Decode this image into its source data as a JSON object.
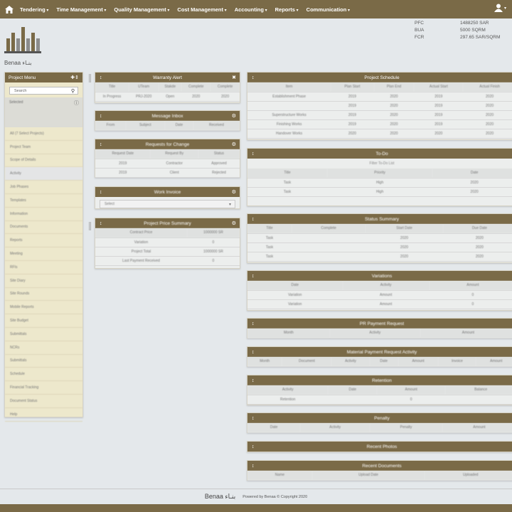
{
  "nav": {
    "home_icon": "home-icon",
    "items": [
      "Tendering",
      "Time Management",
      "Quality Management",
      "Cost Management",
      "Accounting",
      "Reports",
      "Communication"
    ],
    "user_icon": "user-icon"
  },
  "logo": {
    "text": "Benaa بنـاء"
  },
  "project_info": {
    "rows": [
      {
        "label": "PFC",
        "value": "1488250 SAR"
      },
      {
        "label": "BUA",
        "value": "5000 SQRM"
      },
      {
        "label": "FCR",
        "value": "297.65 SAR/SQRM"
      }
    ]
  },
  "project_menu": {
    "title": "Project Menu",
    "search_placeholder": "Search",
    "items": [
      "All (7 Select Projects)",
      "Project Team",
      "Scope of Details",
      "Activity",
      "Job Phases",
      "Templates",
      "Information",
      "Documents",
      "Reports",
      "Meeting",
      "RFIs",
      "Site Diary",
      "Site Rounds",
      "Mobile Reports",
      "Site Budget",
      "Submittals",
      "NCRs",
      "Submittals",
      "Schedule",
      "Financial Tracking",
      "Document Status",
      "Help"
    ],
    "selected_index": 3
  },
  "panels": {
    "warranty": {
      "title": "Warranty Alert",
      "columns": [
        "Title",
        "UTeam",
        "Stakde",
        "Complete",
        "Complete"
      ],
      "row": [
        "In Progress",
        "PRJ-2020",
        "Open",
        "2020",
        "2020"
      ]
    },
    "message": {
      "title": "Message Inbox",
      "columns": [
        "From",
        "Subject",
        "Date",
        "Received"
      ]
    },
    "requests": {
      "title": "Requests for Change",
      "columns": [
        "Request Date",
        "Request By",
        "Status"
      ],
      "rows": [
        [
          "2019",
          "Contractor",
          "Approved"
        ],
        [
          "2019",
          "Client",
          "Rejected"
        ]
      ]
    },
    "work_invoice": {
      "title": "Work Invoice",
      "dropdown": "Select"
    },
    "price": {
      "title": "Project Price Summary",
      "rows": [
        [
          "Contract Price",
          "1000000 SR"
        ],
        [
          "Variation",
          "0"
        ],
        [
          "Project Total",
          "1000000 SR"
        ],
        [
          "Last Payment Received",
          "0"
        ]
      ]
    },
    "schedule": {
      "title": "Project Schedule",
      "columns": [
        "Item",
        "Plan Start",
        "Plan End",
        "Actual Start",
        "Actual Finish"
      ],
      "rows": [
        [
          "Establishment Phase",
          "2019",
          "2020",
          "2019",
          "2020"
        ],
        [
          "",
          "2019",
          "2020",
          "2019",
          "2020"
        ],
        [
          "Superstructure Works",
          "2019",
          "2020",
          "2019",
          "2020"
        ],
        [
          "Finishing Works",
          "2019",
          "2020",
          "2019",
          "2020"
        ],
        [
          "Handover Works",
          "2020",
          "2020",
          "2020",
          "2020"
        ]
      ]
    },
    "todo": {
      "title": "To-Do",
      "subtitle": "Filter To-Do List",
      "columns": [
        "Title",
        "Priority",
        "Date"
      ],
      "rows": [
        [
          "Task",
          "High",
          "2020"
        ],
        [
          "Task",
          "High",
          "2020"
        ]
      ]
    },
    "status": {
      "title": "Status Summary",
      "columns": [
        "Title",
        "Complete",
        "Start Date",
        "Due Date"
      ],
      "rows": [
        [
          "Task",
          "",
          "2020",
          "2020"
        ],
        [
          "Task",
          "",
          "2020",
          "2020"
        ],
        [
          "Task",
          "",
          "2020",
          "2020"
        ]
      ]
    },
    "variations": {
      "title": "Variations",
      "columns": [
        "Date",
        "Activity",
        "Amount"
      ],
      "rows": [
        [
          "Variation",
          "Amount",
          "0"
        ],
        [
          "Variation",
          "Amount",
          "0"
        ]
      ]
    },
    "pr_request": {
      "title": "PR Payment Request",
      "columns": [
        "Month",
        "Activity",
        "Amount"
      ]
    },
    "material": {
      "title": "Material Payment Request Activity",
      "columns": [
        "Month",
        "Document",
        "Activity",
        "Date",
        "Amount",
        "Invoice",
        "Amount"
      ]
    },
    "retention": {
      "title": "Retention",
      "columns": [
        "Activity",
        "Date",
        "Amount",
        "Balance"
      ],
      "row": [
        "Retention",
        "",
        "0",
        ""
      ]
    },
    "penalty": {
      "title": "Penalty",
      "columns": [
        "Date",
        "Activity",
        "Penalty",
        "Amount"
      ]
    },
    "recent_photos": {
      "title": "Recent Photos"
    },
    "recent_documents": {
      "title": "Recent Documents",
      "columns": [
        "Name",
        "Upload Date",
        "Uploaded"
      ]
    }
  },
  "footer": {
    "brand": "Benaa بنـاء",
    "copyright": "Powered by Benaa © Copyright 2020"
  }
}
